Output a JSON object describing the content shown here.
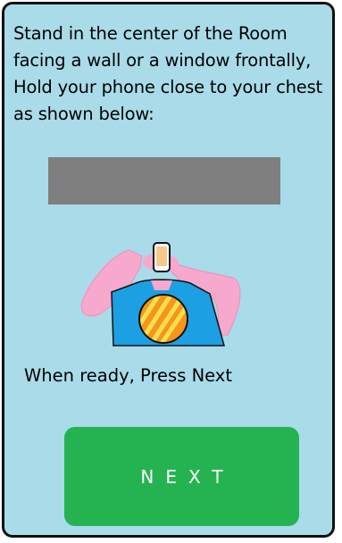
{
  "instructions": {
    "line1": "Stand in the center of the Room",
    "line2": "facing a wall or a window frontally,",
    "line3": "Hold your phone close to your chest",
    "line4": "as shown below:"
  },
  "illustration": {
    "icon": "person-holding-phone-illustration",
    "colors": {
      "skin": "#f7a8cd",
      "shirt": "#1d9fe3",
      "pendant": "#f7941d",
      "pendant_stripes": "#f4e04d"
    }
  },
  "ready_text": "When ready, Press Next",
  "next_button": {
    "label": "NEXT",
    "color": "#25b352"
  },
  "colors": {
    "background": "#a9dbe9",
    "placeholder_bar": "#7f7f7f"
  }
}
